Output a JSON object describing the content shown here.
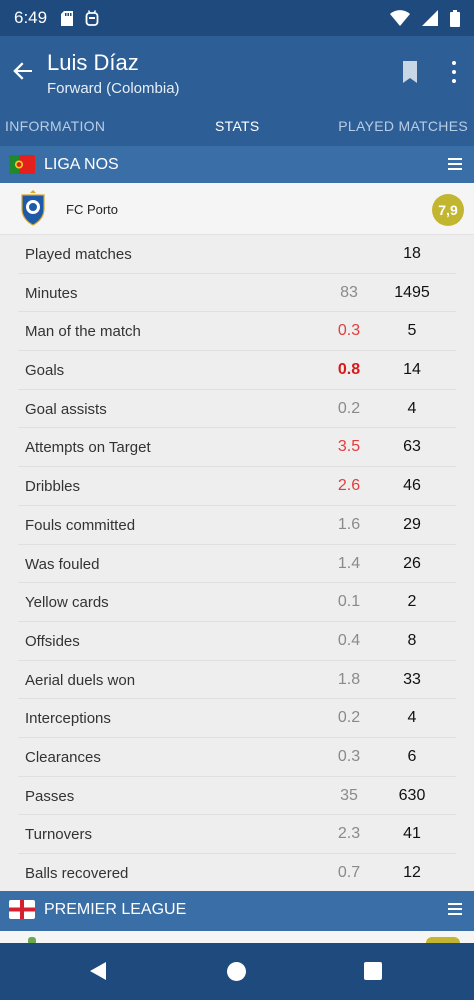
{
  "status_bar": {
    "time": "6:49",
    "icons_left": [
      "sd-card-icon",
      "android-icon"
    ],
    "icons_right": [
      "wifi-icon",
      "signal-icon",
      "battery-icon"
    ]
  },
  "app_bar": {
    "title": "Luis Díaz",
    "subtitle": "Forward (Colombia)",
    "icons": [
      "back-arrow-icon",
      "bookmark-icon",
      "more-vert-icon"
    ]
  },
  "tabs": [
    {
      "label": "INFORMATION",
      "active": false
    },
    {
      "label": "STATS",
      "active": true
    },
    {
      "label": "PLAYED MATCHES",
      "active": false
    }
  ],
  "leagues": [
    {
      "name": "LIGA NOS",
      "flag": "portugal-flag-icon"
    },
    {
      "name": "PREMIER LEAGUE",
      "flag": "england-flag-icon"
    }
  ],
  "team": {
    "name": "FC Porto",
    "logo": "fc-porto-crest-icon",
    "rating": "7,9"
  },
  "stats": [
    {
      "label": "Played matches",
      "avg": "",
      "total": "18",
      "level": "normal"
    },
    {
      "label": "Minutes",
      "avg": "83",
      "total": "1495",
      "level": "normal"
    },
    {
      "label": "Man of the match",
      "avg": "0.3",
      "total": "5",
      "level": "hi"
    },
    {
      "label": "Goals",
      "avg": "0.8",
      "total": "14",
      "level": "top"
    },
    {
      "label": "Goal assists",
      "avg": "0.2",
      "total": "4",
      "level": "normal"
    },
    {
      "label": "Attempts on Target",
      "avg": "3.5",
      "total": "63",
      "level": "hi"
    },
    {
      "label": "Dribbles",
      "avg": "2.6",
      "total": "46",
      "level": "hi"
    },
    {
      "label": "Fouls committed",
      "avg": "1.6",
      "total": "29",
      "level": "normal"
    },
    {
      "label": "Was fouled",
      "avg": "1.4",
      "total": "26",
      "level": "normal"
    },
    {
      "label": "Yellow cards",
      "avg": "0.1",
      "total": "2",
      "level": "normal"
    },
    {
      "label": "Offsides",
      "avg": "0.4",
      "total": "8",
      "level": "normal"
    },
    {
      "label": "Aerial duels won",
      "avg": "1.8",
      "total": "33",
      "level": "normal"
    },
    {
      "label": "Interceptions",
      "avg": "0.2",
      "total": "4",
      "level": "normal"
    },
    {
      "label": "Clearances",
      "avg": "0.3",
      "total": "6",
      "level": "normal"
    },
    {
      "label": "Passes",
      "avg": "35",
      "total": "630",
      "level": "normal"
    },
    {
      "label": "Turnovers",
      "avg": "2.3",
      "total": "41",
      "level": "normal"
    },
    {
      "label": "Balls recovered",
      "avg": "0.7",
      "total": "12",
      "level": "normal"
    }
  ],
  "colors": {
    "status_bar": "#1e4a7e",
    "app_bar": "#2d5f96",
    "league_bar": "#3a6ea6",
    "rating": "#c2b630",
    "highlight": "#e03d3d",
    "top_highlight": "#d61a1a"
  }
}
